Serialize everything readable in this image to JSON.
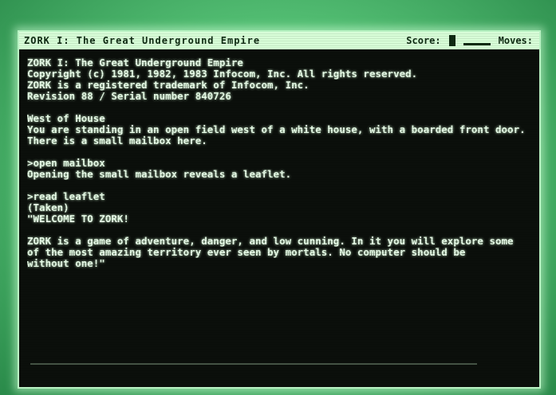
{
  "window": {
    "title": "ZORK I: The Great Underground Empire",
    "score_label": "Score:",
    "moves_label": "Moves:"
  },
  "transcript": [
    "ZORK I: The Great Underground Empire",
    "Copyright (c) 1981, 1982, 1983 Infocom, Inc. All rights reserved.",
    "ZORK is a registered trademark of Infocom, Inc.",
    "Revision 88 / Serial number 840726",
    "",
    "West of House",
    "You are standing in an open field west of a white house, with a boarded front door.",
    "There is a small mailbox here.",
    "",
    ">open mailbox",
    "Opening the small mailbox reveals a leaflet.",
    "",
    ">read leaflet",
    "(Taken)",
    "\"WELCOME TO ZORK!",
    "",
    "ZORK is a game of adventure, danger, and low cunning. In it you will explore some",
    "of the most amazing territory ever seen by mortals. No computer should be",
    "without one!\""
  ]
}
